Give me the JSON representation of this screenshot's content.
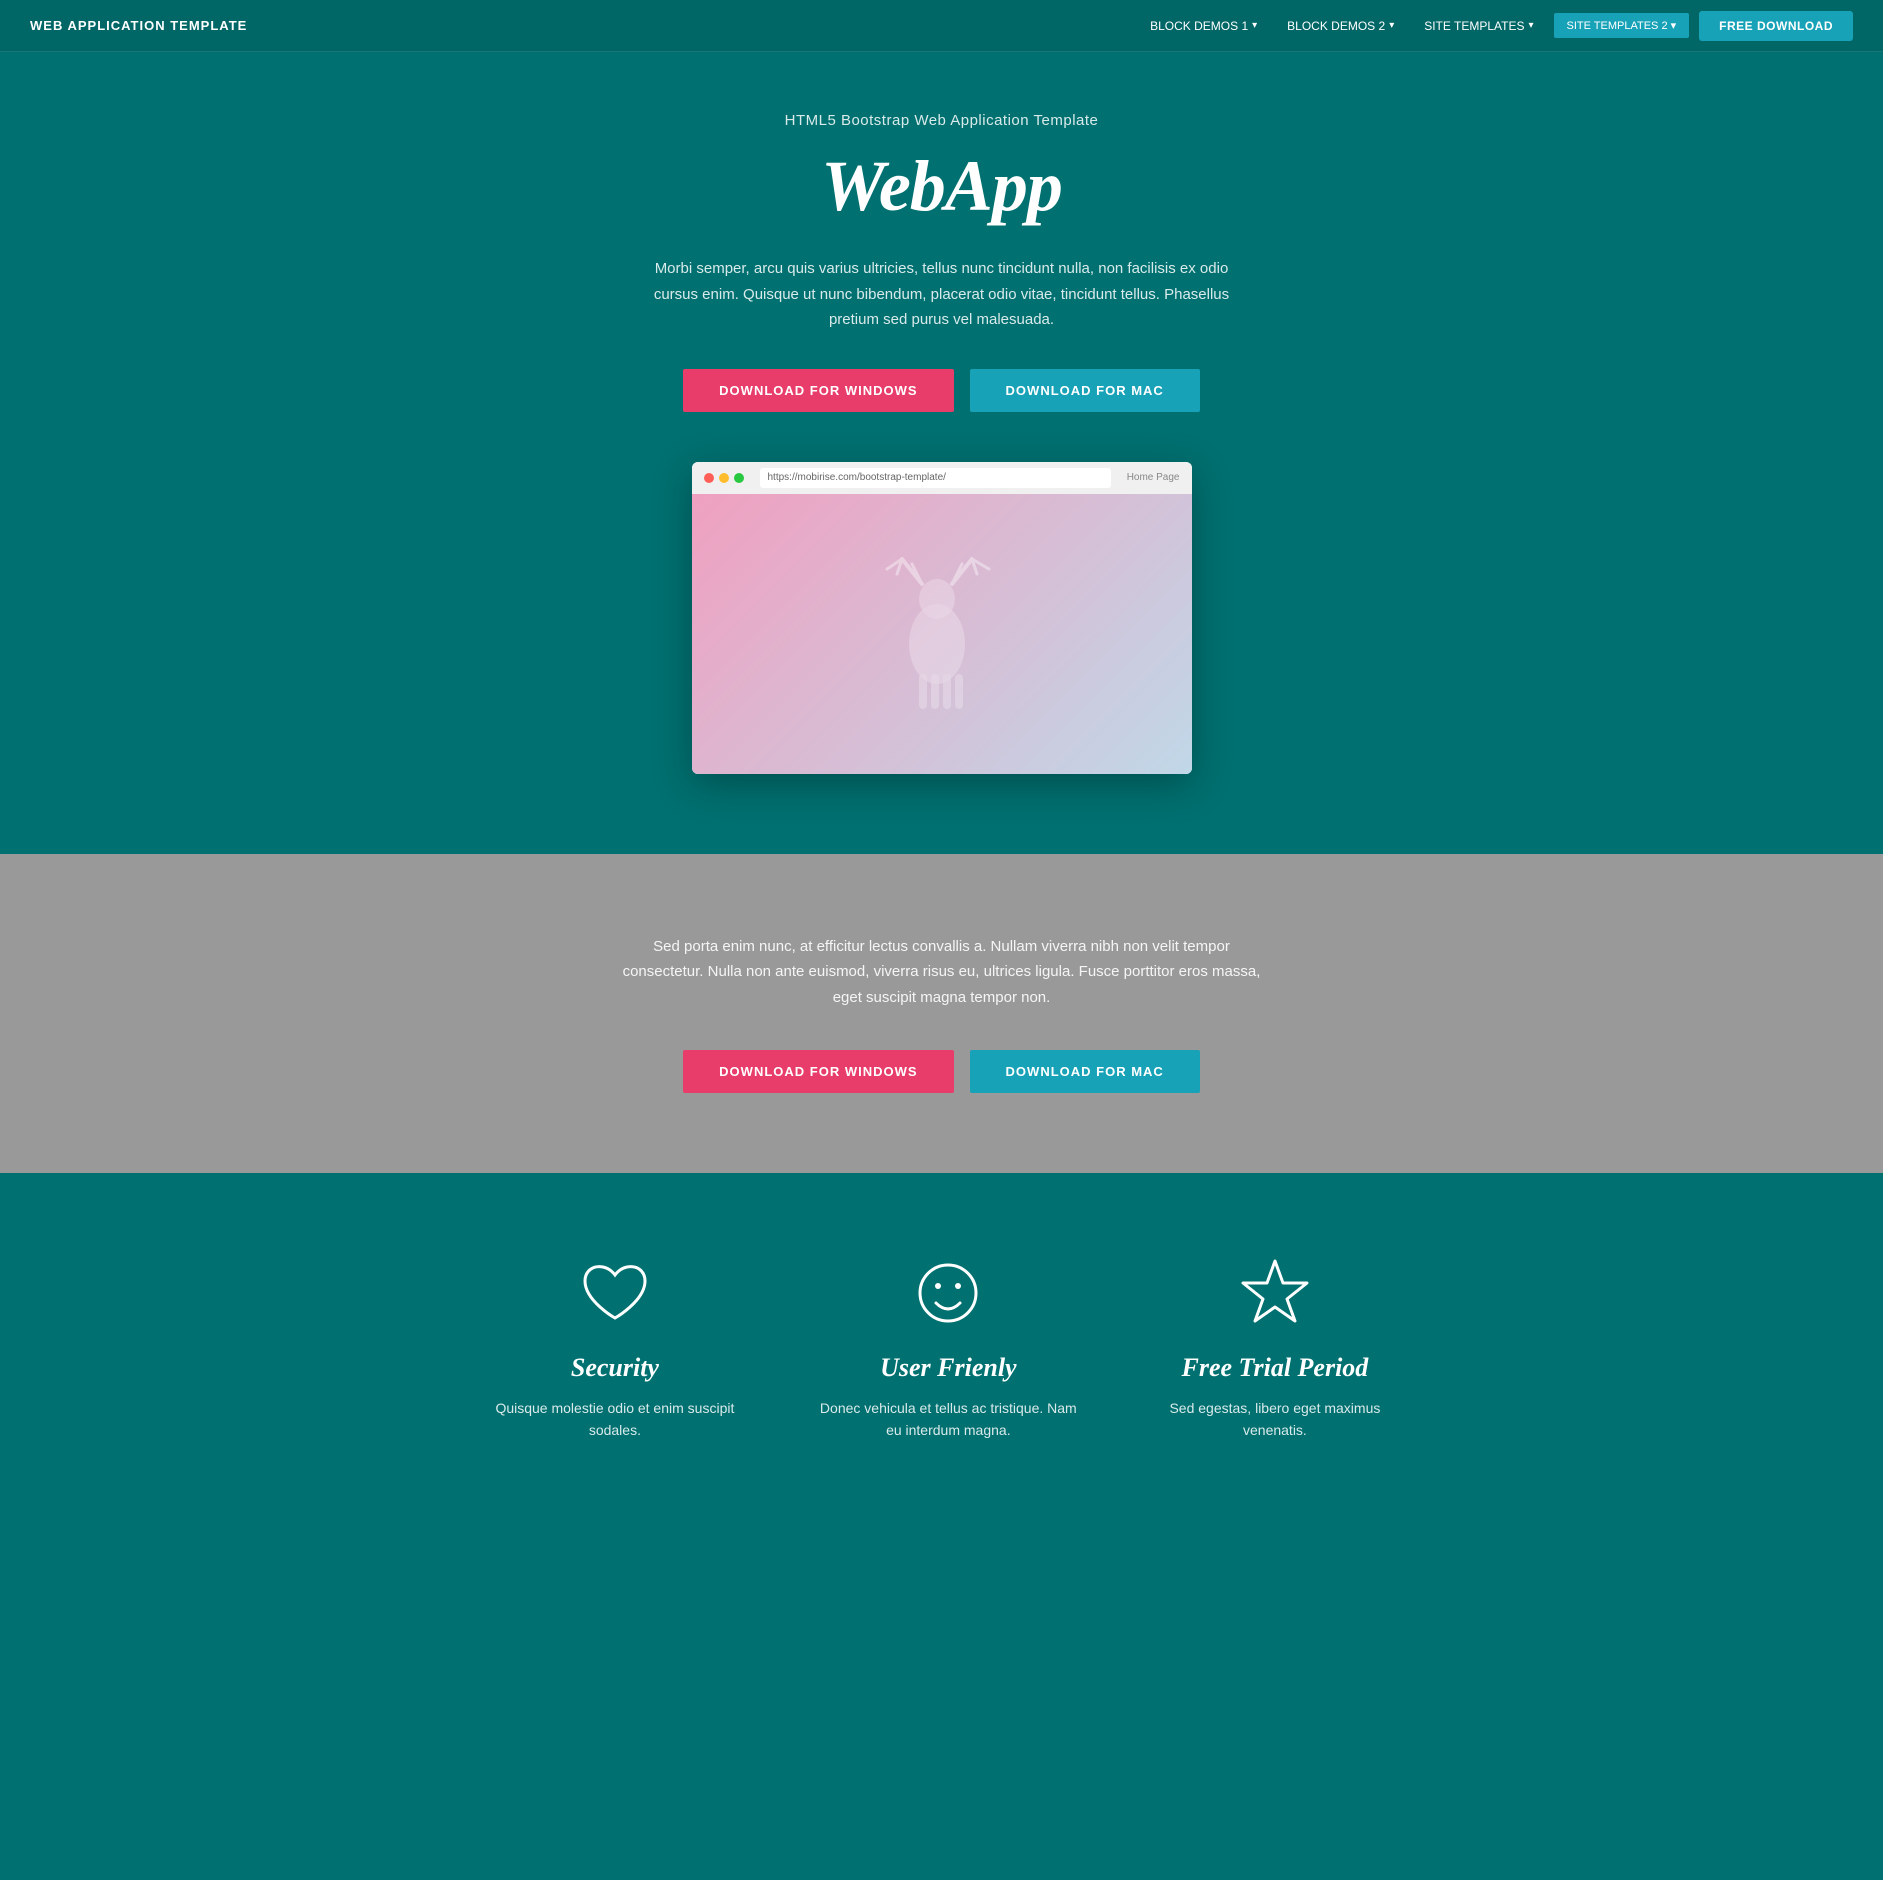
{
  "navbar": {
    "brand": "WEB APPLICATION TEMPLATE",
    "links": [
      {
        "label": "BLOCK DEMOS 1",
        "has_dropdown": true
      },
      {
        "label": "BLOCK DEMOS 2",
        "has_dropdown": true
      },
      {
        "label": "SITE TEMPLATES",
        "has_dropdown": true
      }
    ],
    "active_dropdown": "SITE TEMPLATES 2",
    "free_download": "FREE DOWNLOAD"
  },
  "hero": {
    "subtitle": "HTML5 Bootstrap Web Application Template",
    "title": "WebApp",
    "description": "Morbi semper, arcu quis varius ultricies, tellus nunc tincidunt nulla, non facilisis ex odio cursus enim. Quisque ut nunc bibendum, placerat odio vitae, tincidunt tellus. Phasellus pretium sed purus vel malesuada.",
    "btn_windows": "DOWNLOAD FOR WINDOWS",
    "btn_mac": "DOWNLOAD FOR MAC",
    "browser_url": "https://mobirise.com/bootstrap-template/",
    "browser_home": "Home Page"
  },
  "grey_section": {
    "description": "Sed porta enim nunc, at efficitur lectus convallis a. Nullam viverra nibh non velit tempor consectetur. Nulla non ante euismod, viverra risus eu, ultrices ligula. Fusce porttitor eros massa, eget suscipit magna tempor non.",
    "btn_windows": "DOWNLOAD FOR WINDOWS",
    "btn_mac": "DOWNLOAD FOR MAC"
  },
  "features": {
    "items": [
      {
        "icon": "heart",
        "title": "Security",
        "description": "Quisque molestie odio et enim suscipit sodales."
      },
      {
        "icon": "smiley",
        "title": "User Frienly",
        "description": "Donec vehicula et tellus ac tristique. Nam eu interdum magna."
      },
      {
        "icon": "star",
        "title": "Free Trial Period",
        "description": "Sed egestas, libero eget maximus venenatis."
      }
    ]
  }
}
